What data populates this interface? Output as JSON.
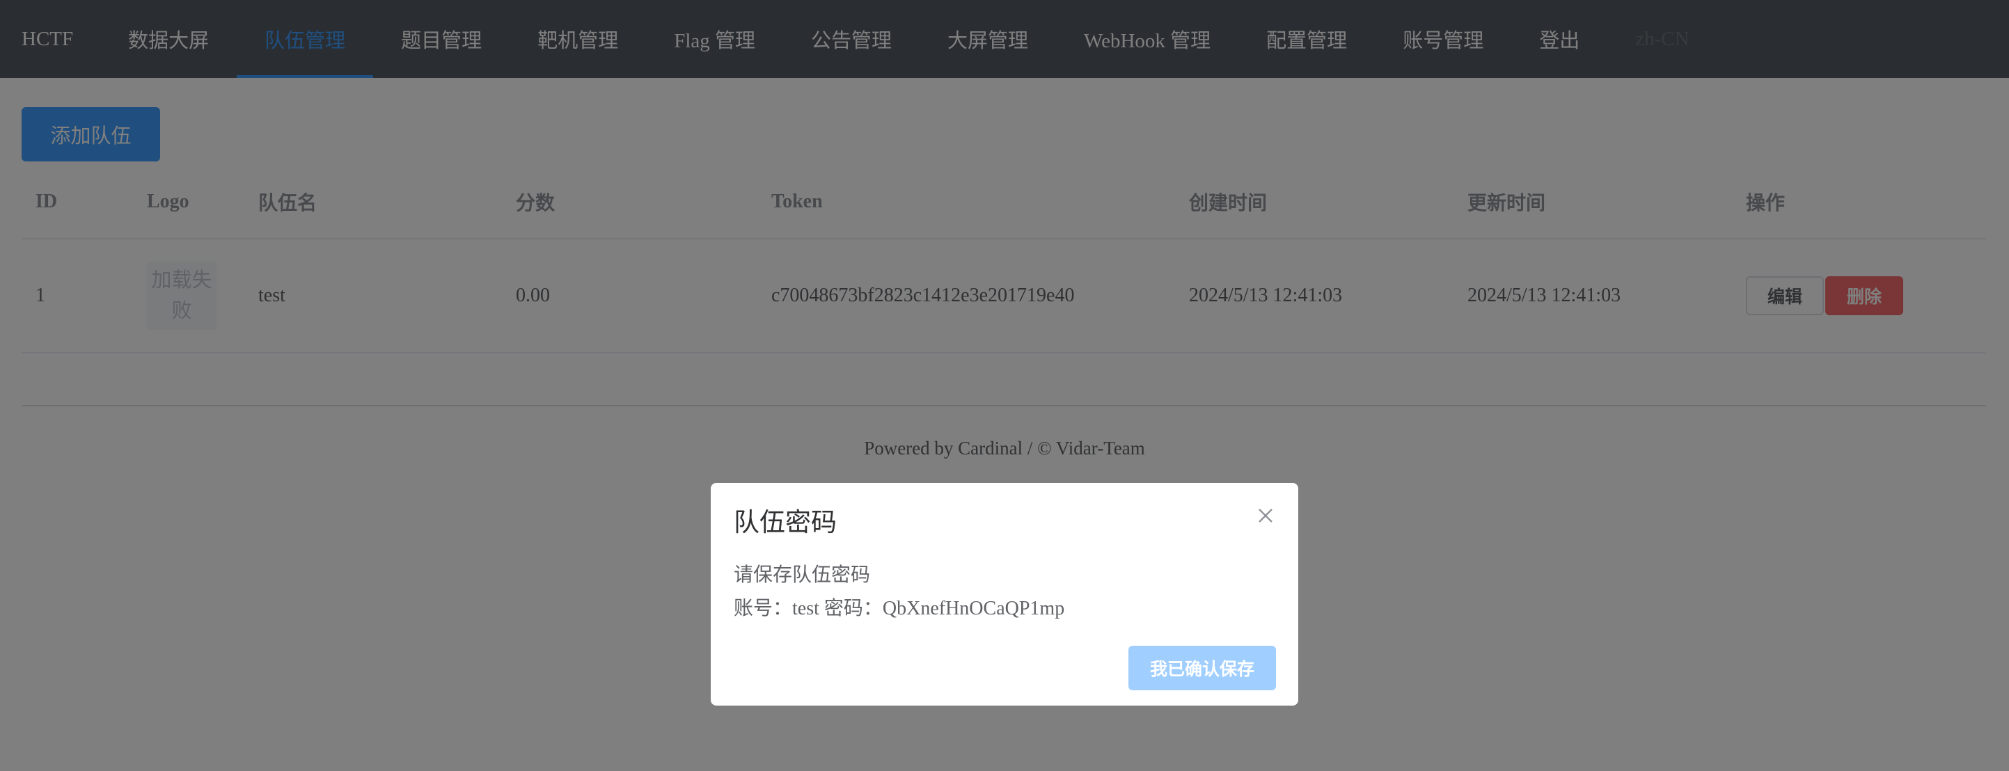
{
  "nav": {
    "brand": "HCTF",
    "items": [
      {
        "label": "数据大屏"
      },
      {
        "label": "队伍管理"
      },
      {
        "label": "题目管理"
      },
      {
        "label": "靶机管理"
      },
      {
        "label": "Flag 管理"
      },
      {
        "label": "公告管理"
      },
      {
        "label": "大屏管理"
      },
      {
        "label": "WebHook 管理"
      },
      {
        "label": "配置管理"
      },
      {
        "label": "账号管理"
      },
      {
        "label": "登出"
      }
    ],
    "locale": "zh-CN",
    "active_index": 1
  },
  "toolbar": {
    "add_team_label": "添加队伍"
  },
  "table": {
    "headers": {
      "id": "ID",
      "logo": "Logo",
      "name": "队伍名",
      "score": "分数",
      "token": "Token",
      "created": "创建时间",
      "updated": "更新时间",
      "ops": "操作"
    },
    "rows": [
      {
        "id": "1",
        "logo_text": "加载失败",
        "name": "test",
        "score": "0.00",
        "token": "c70048673bf2823c1412e3e201719e40",
        "created": "2024/5/13 12:41:03",
        "updated": "2024/5/13 12:41:03",
        "edit_label": "编辑",
        "delete_label": "删除"
      }
    ]
  },
  "footer": {
    "text": "Powered by Cardinal / © Vidar-Team"
  },
  "dialog": {
    "title": "队伍密码",
    "message": "请保存队伍密码",
    "credentials": "账号：test 密码：QbXnefHnOCaQP1mp",
    "confirm_label": "我已确认保存"
  },
  "colors": {
    "nav_bg": "#545c64",
    "accent": "#409eff",
    "danger": "#f56c6c",
    "confirm_disabled": "#a0cfff"
  }
}
